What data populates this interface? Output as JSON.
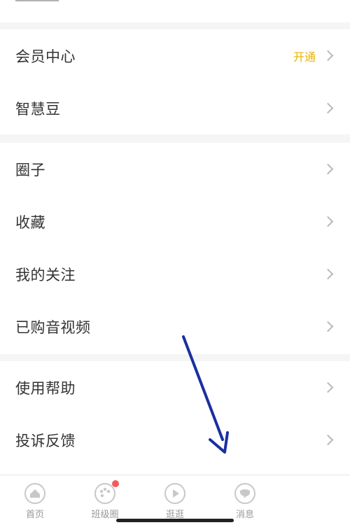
{
  "menu": {
    "group1": [
      {
        "label": "会员中心",
        "extra": "开通"
      },
      {
        "label": "智慧豆",
        "extra": ""
      }
    ],
    "group2": [
      {
        "label": "圈子"
      },
      {
        "label": "收藏"
      },
      {
        "label": "我的关注"
      },
      {
        "label": "已购音视频"
      }
    ],
    "group3": [
      {
        "label": "使用帮助"
      },
      {
        "label": "投诉反馈"
      }
    ]
  },
  "tabbar": {
    "items": [
      {
        "label": "首页",
        "icon": "home-icon"
      },
      {
        "label": "班级圈",
        "icon": "palette-icon",
        "badge": true
      },
      {
        "label": "逛逛",
        "icon": "play-icon"
      },
      {
        "label": "消息",
        "icon": "message-icon"
      }
    ]
  },
  "colors": {
    "accent": "#e8b400",
    "badge": "#f25c5c",
    "arrow": "#1a2fa0",
    "icon": "#c8c8c8"
  }
}
